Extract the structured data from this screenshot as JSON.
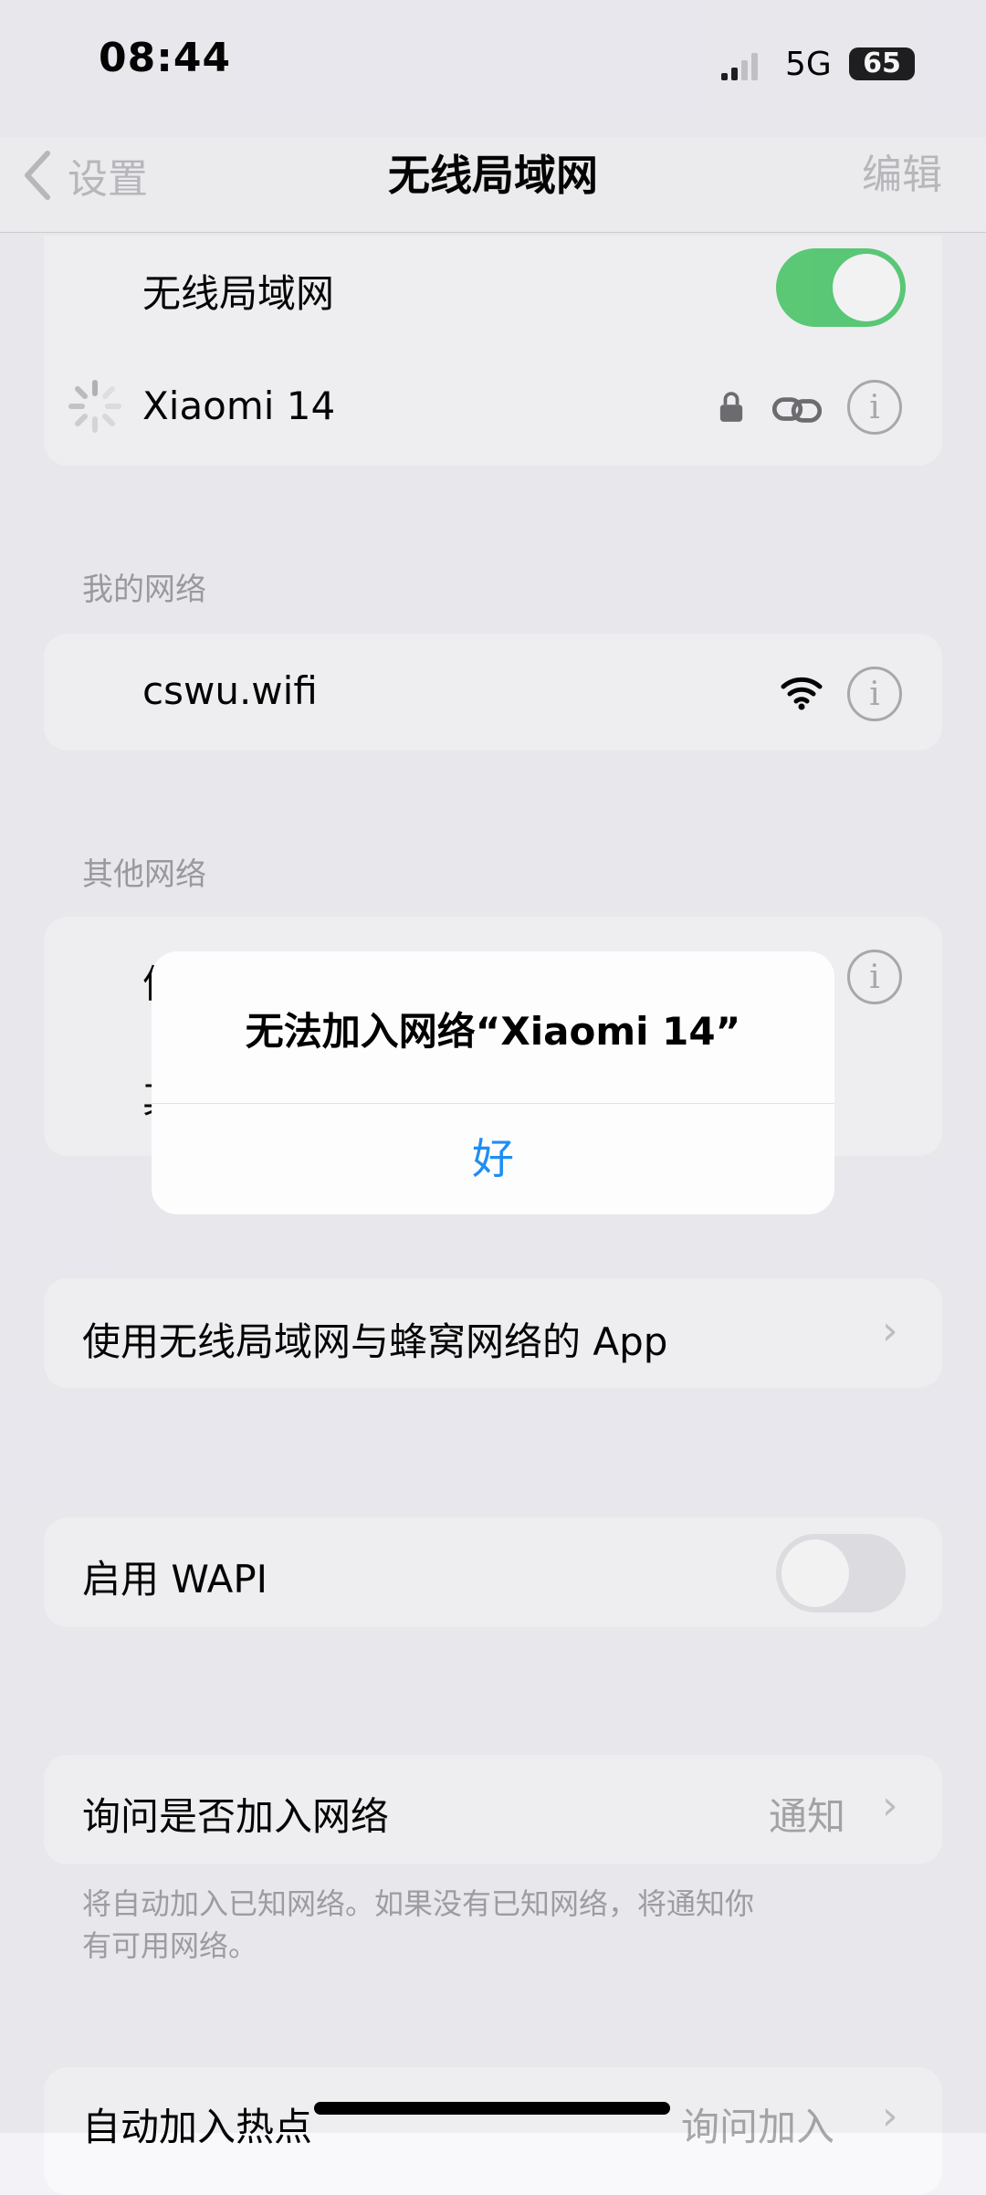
{
  "status_bar": {
    "time": "08:44",
    "network": "5G",
    "battery": "65"
  },
  "nav": {
    "back_label": "设置",
    "title": "无线局域网",
    "edit_label": "编辑"
  },
  "wifi_card": {
    "wifi_label": "无线局域网",
    "wifi_on": true,
    "connecting_network": "Xiaomi 14"
  },
  "my_networks": {
    "header": "我的网络",
    "items": [
      {
        "name": "cswu.wifi"
      }
    ]
  },
  "other_networks": {
    "header": "其他网络",
    "items": [
      {
        "name": "信"
      },
      {
        "name": "其"
      }
    ]
  },
  "alert": {
    "title": "无法加入网络“Xiaomi 14”",
    "ok_label": "好"
  },
  "apps_row": {
    "label": "使用无线局域网与蜂窝网络的 App"
  },
  "wapi_row": {
    "label": "启用 WAPI",
    "enabled": false
  },
  "ask_join": {
    "label": "询问是否加入网络",
    "value": "通知",
    "footnote_line1": "将自动加入已知网络。如果没有已知网络，将通知你",
    "footnote_line2": "有可用网络。"
  },
  "auto_hotspot": {
    "label": "自动加入热点",
    "value": "询问加入"
  },
  "colors": {
    "accent_blue": "#1e8ef5",
    "toggle_green": "#34c759",
    "background": "#f2f2f7"
  }
}
